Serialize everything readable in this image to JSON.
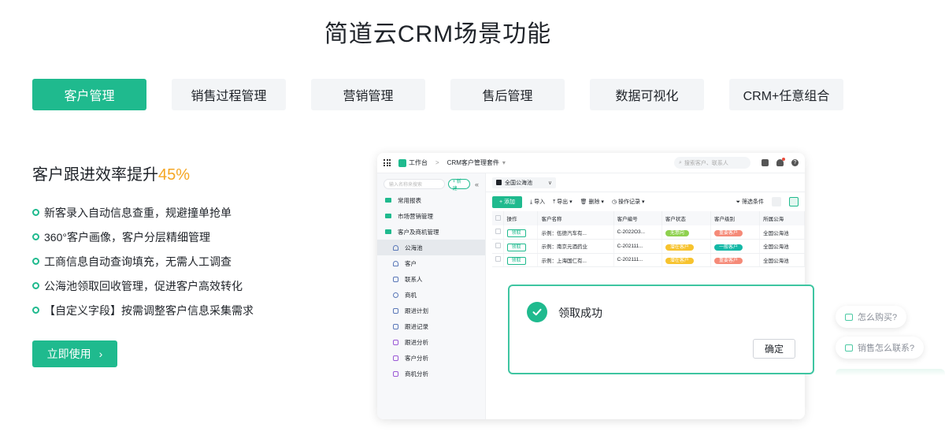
{
  "page": {
    "title": "简道云CRM场景功能"
  },
  "tabs": [
    {
      "label": "客户管理",
      "active": true
    },
    {
      "label": "销售过程管理",
      "active": false
    },
    {
      "label": "营销管理",
      "active": false
    },
    {
      "label": "售后管理",
      "active": false
    },
    {
      "label": "数据可视化",
      "active": false
    },
    {
      "label": "CRM+任意组合",
      "active": false
    }
  ],
  "hero": {
    "headline": "客户跟进效率提升",
    "headline_accent": "45%",
    "features": [
      "新客录入自动信息查重，规避撞单抢单",
      "360°客户画像，客户分层精细管理",
      "工商信息自动查询填充，无需人工调查",
      "公海池领取回收管理，促进客户高效转化",
      "【自定义字段】按需调整客户信息采集需求"
    ],
    "cta_label": "立即使用",
    "cta_arrow": "›"
  },
  "app": {
    "workbench": "工作台",
    "crumb_sep": ">",
    "suite": "CRM客户管理套件",
    "suite_dd": "▾",
    "search_placeholder": "搜索客户、联系人",
    "help": "?",
    "sidebar": {
      "search_placeholder": "输入名称来搜索",
      "new_label": "+ 新建",
      "collapse": "«",
      "items": [
        {
          "label": "常用报表",
          "type": "folder"
        },
        {
          "label": "市场营销管理",
          "type": "folder"
        },
        {
          "label": "客户及商机管理",
          "type": "folder"
        },
        {
          "label": "公海池",
          "type": "person",
          "active": true
        },
        {
          "label": "客户",
          "type": "person"
        },
        {
          "label": "联系人",
          "type": "doc"
        },
        {
          "label": "商机",
          "type": "circle"
        },
        {
          "label": "跟进计划",
          "type": "doc"
        },
        {
          "label": "跟进记录",
          "type": "doc"
        },
        {
          "label": "跟进分析",
          "type": "chart"
        },
        {
          "label": "客户分析",
          "type": "chart"
        },
        {
          "label": "商机分析",
          "type": "chart"
        }
      ]
    },
    "pool_select": "全国公海池",
    "pool_chev": "∨",
    "toolbar": {
      "add": "+ 添加",
      "import": "导入",
      "export": "导出 ▾",
      "delete": "删除 ▾",
      "log": "操作记录 ▾",
      "filter": "筛选条件"
    },
    "table": {
      "headers": [
        "操作",
        "客户名称",
        "客户编号",
        "客户状态",
        "客户级别",
        "所属公海"
      ],
      "rows": [
        {
          "action": "领取",
          "name": "示例：伍德汽车有...",
          "code": "C-2022O3...",
          "status": "无意向",
          "status_color": "g",
          "level": "重要客户",
          "level_color": "r",
          "pool": "全国公海池"
        },
        {
          "action": "领取",
          "name": "示例：南京元酒药业",
          "code": "C-202111...",
          "status": "潜在客户",
          "status_color": "y",
          "level": "一般客户",
          "level_color": "t",
          "pool": "全国公海池"
        },
        {
          "action": "领取",
          "name": "示例：上海国仁有...",
          "code": "C-202111...",
          "status": "潜在客户",
          "status_color": "y",
          "level": "重要客户",
          "level_color": "r",
          "pool": "全国公海池"
        }
      ]
    }
  },
  "dialog": {
    "message": "领取成功",
    "ok": "确定"
  },
  "chat": [
    "怎么购买?",
    "销售怎么联系?"
  ],
  "colors": {
    "brand": "#1fba8e",
    "accent": "#f5a623"
  }
}
